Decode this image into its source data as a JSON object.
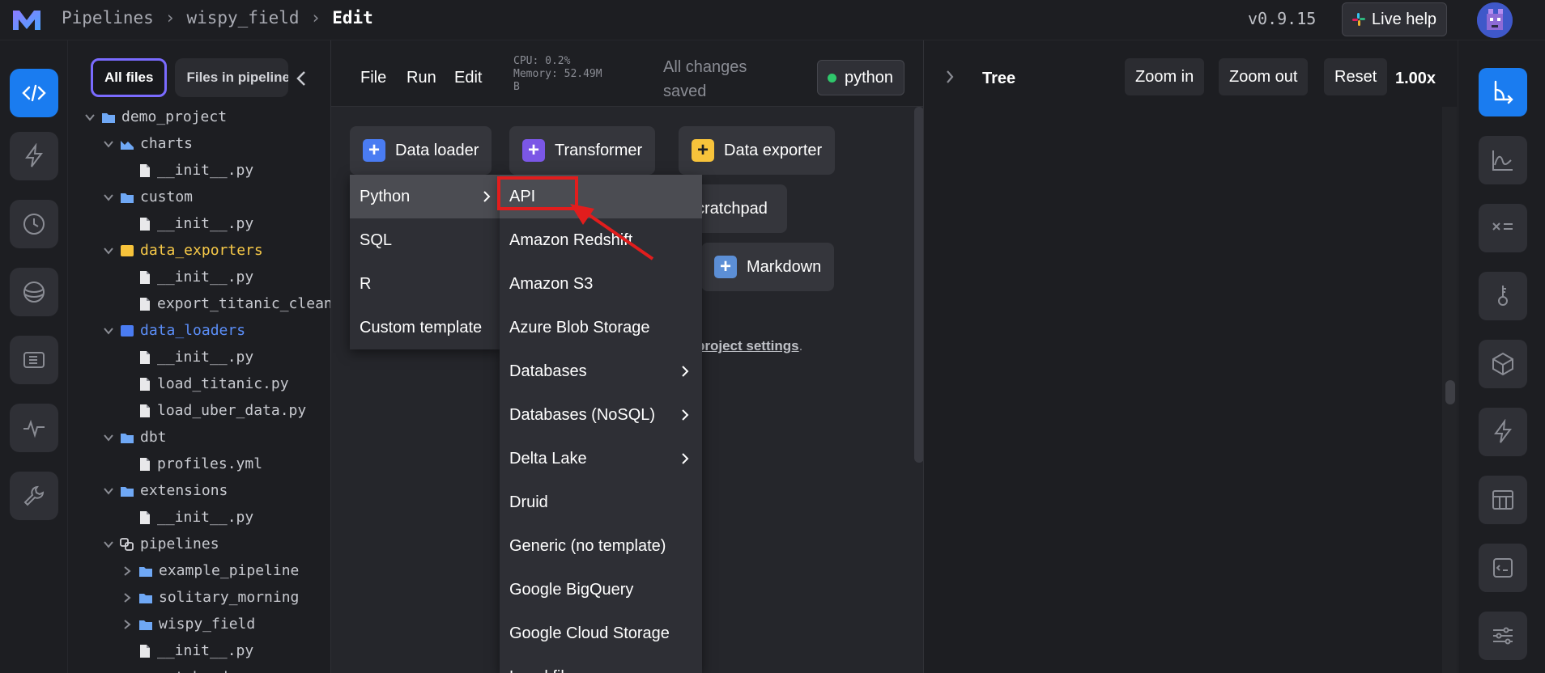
{
  "breadcrumb": {
    "root": "Pipelines",
    "pipeline": "wispy_field",
    "current": "Edit"
  },
  "version": "v0.9.15",
  "live_help": "Live help",
  "file_tabs": {
    "all": "All files",
    "pipeline": "Files in pipeline"
  },
  "file_tree": [
    {
      "label": "demo_project",
      "type": "folder",
      "open": true,
      "color": "default"
    },
    {
      "label": "charts",
      "type": "chart-folder",
      "open": true,
      "color": "default"
    },
    {
      "label": "__init__.py",
      "type": "file"
    },
    {
      "label": "custom",
      "type": "folder",
      "open": true,
      "color": "default"
    },
    {
      "label": "__init__.py",
      "type": "file"
    },
    {
      "label": "data_exporters",
      "type": "folder",
      "open": true,
      "color": "yellow"
    },
    {
      "label": "__init__.py",
      "type": "file"
    },
    {
      "label": "export_titanic_clean",
      "type": "file"
    },
    {
      "label": "data_loaders",
      "type": "folder",
      "open": true,
      "color": "blue"
    },
    {
      "label": "__init__.py",
      "type": "file"
    },
    {
      "label": "load_titanic.py",
      "type": "file"
    },
    {
      "label": "load_uber_data.py",
      "type": "file"
    },
    {
      "label": "dbt",
      "type": "folder",
      "open": true,
      "color": "default"
    },
    {
      "label": "profiles.yml",
      "type": "file"
    },
    {
      "label": "extensions",
      "type": "folder",
      "open": true,
      "color": "default"
    },
    {
      "label": "__init__.py",
      "type": "file"
    },
    {
      "label": "pipelines",
      "type": "pipelines-folder",
      "open": true,
      "color": "default"
    },
    {
      "label": "example_pipeline",
      "type": "folder",
      "open": false,
      "color": "default"
    },
    {
      "label": "solitary_morning",
      "type": "folder",
      "open": false,
      "color": "default"
    },
    {
      "label": "wispy_field",
      "type": "folder",
      "open": false,
      "color": "default"
    },
    {
      "label": "__init__.py",
      "type": "file"
    },
    {
      "label": "scratchpads",
      "type": "folder",
      "open": false,
      "color": "default"
    }
  ],
  "menu": {
    "file": "File",
    "run": "Run",
    "edit": "Edit"
  },
  "sysinfo": {
    "cpu": "CPU: 0.2%",
    "memory": "Memory: 52.49M",
    "memory_unit": "B"
  },
  "save_status": "All changes saved",
  "kernel": "python",
  "add_blocks": {
    "data_loader": "Data loader",
    "transformer": "Transformer",
    "data_exporter": "Data exporter",
    "scratchpad": "cratchpad",
    "markdown": "Markdown"
  },
  "hint": {
    "link": "project settings",
    "after": "."
  },
  "language_menu": [
    "Python",
    "SQL",
    "R",
    "Custom template"
  ],
  "python_menu": [
    {
      "label": "API",
      "sub": false
    },
    {
      "label": "Amazon Redshift",
      "sub": false
    },
    {
      "label": "Amazon S3",
      "sub": false
    },
    {
      "label": "Azure Blob Storage",
      "sub": false
    },
    {
      "label": "Databases",
      "sub": true
    },
    {
      "label": "Databases (NoSQL)",
      "sub": true
    },
    {
      "label": "Delta Lake",
      "sub": true
    },
    {
      "label": "Druid",
      "sub": false
    },
    {
      "label": "Generic (no template)",
      "sub": false
    },
    {
      "label": "Google BigQuery",
      "sub": false
    },
    {
      "label": "Google Cloud Storage",
      "sub": false
    },
    {
      "label": "Local file",
      "sub": false
    }
  ],
  "tree_panel": {
    "title": "Tree",
    "zoom_in": "Zoom in",
    "zoom_out": "Zoom out",
    "reset": "Reset",
    "zoom": "1.00x"
  },
  "colors": {
    "accent": "#1a7cf0",
    "loader": "#4a7cf2",
    "transformer": "#7b57e6",
    "exporter": "#f7c33b",
    "markdown": "#5c8fd6",
    "annotation": "#e11d1d"
  }
}
